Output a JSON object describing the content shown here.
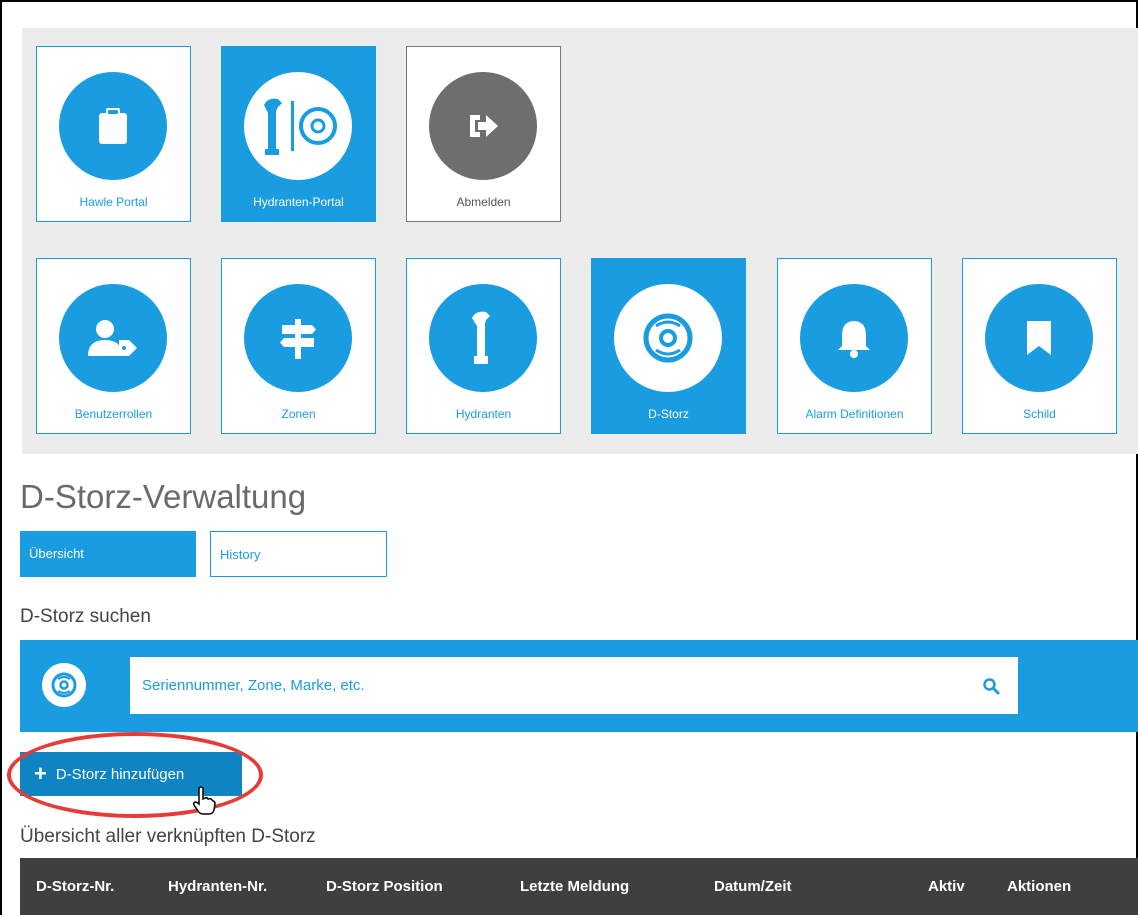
{
  "portal_tiles": [
    {
      "label": "Hawle Portal",
      "icon": "clipboard-icon",
      "active": false
    },
    {
      "label": "Hydranten-Portal",
      "icon": "hydrant-dstorz-icon",
      "active": true
    },
    {
      "label": "Abmelden",
      "icon": "logout-icon",
      "active": false
    }
  ],
  "module_tiles": [
    {
      "label": "Benutzerrollen",
      "icon": "user-tag-icon"
    },
    {
      "label": "Zonen",
      "icon": "signpost-icon"
    },
    {
      "label": "Hydranten",
      "icon": "hydrant-icon"
    },
    {
      "label": "D-Storz",
      "icon": "dstorz-icon",
      "active": true
    },
    {
      "label": "Alarm Definitionen",
      "icon": "bell-icon"
    },
    {
      "label": "Schild",
      "icon": "bookmark-icon"
    }
  ],
  "page": {
    "title": "D-Storz-Verwaltung"
  },
  "tabs": [
    {
      "label": "Übersicht",
      "active": true
    },
    {
      "label": "History",
      "active": false
    }
  ],
  "search": {
    "section_label": "D-Storz suchen",
    "placeholder": "Seriennummer, Zone, Marke, etc."
  },
  "add_button": {
    "label": "D-Storz hinzufügen"
  },
  "table": {
    "section_label": "Übersicht aller verknüpften D-Storz",
    "columns": [
      "D-Storz-Nr.",
      "Hydranten-Nr.",
      "D-Storz Position",
      "Letzte Meldung",
      "Datum/Zeit",
      "Aktiv",
      "Aktionen"
    ]
  },
  "colors": {
    "accent": "#1a9ce0",
    "header_dark": "#3f3f3f",
    "highlight": "#e63b36",
    "logout_gray": "#6e6e6e"
  }
}
